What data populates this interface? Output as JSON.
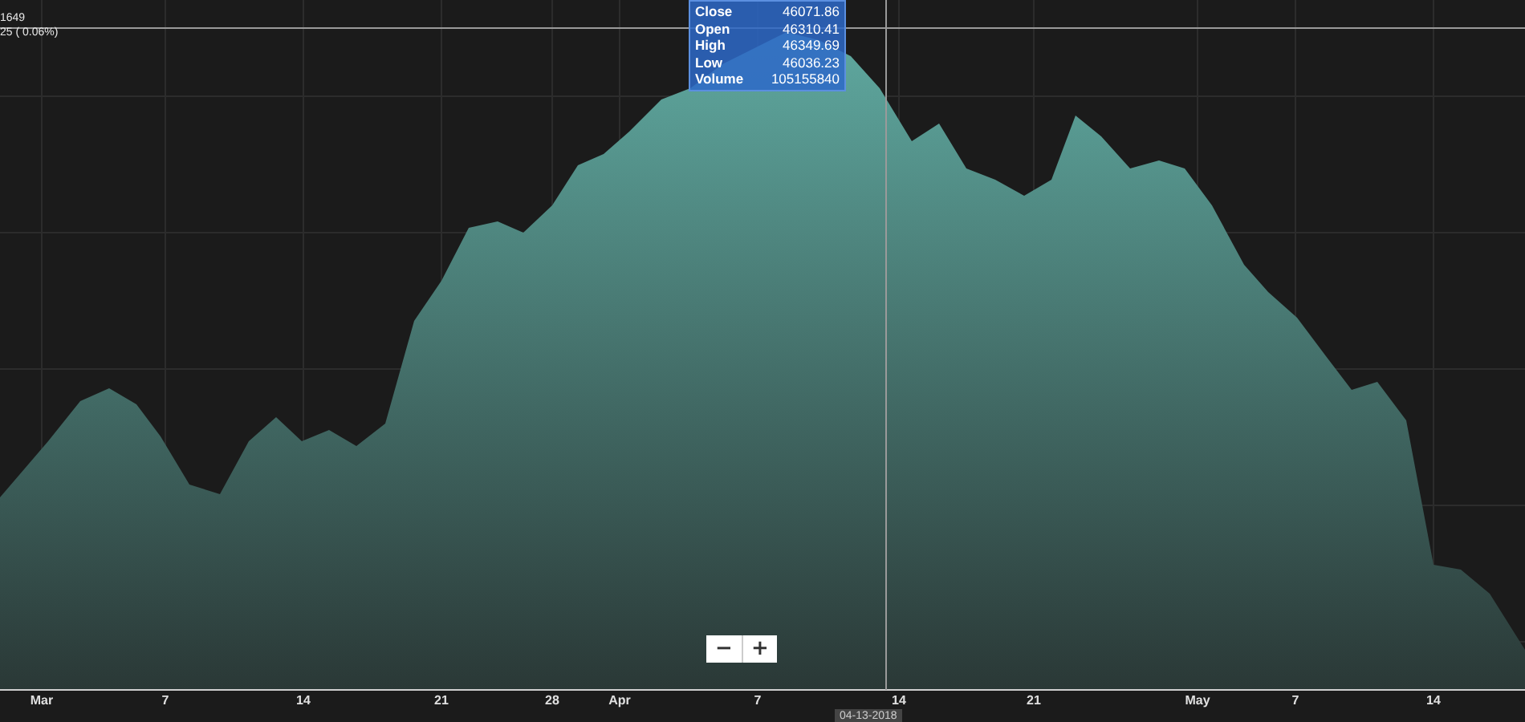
{
  "header": {
    "price": "1649",
    "change": "25 ( 0.06%)"
  },
  "tooltip": [
    {
      "label": "Close",
      "value": "46071.86"
    },
    {
      "label": "Open",
      "value": "46310.41"
    },
    {
      "label": "High",
      "value": "46349.69"
    },
    {
      "label": "Low",
      "value": "46036.23"
    },
    {
      "label": "Volume",
      "value": "105155840"
    }
  ],
  "zoom_buttons": [
    "−",
    "+"
  ],
  "x_axis": [
    "Mar",
    "7",
    "14",
    "21",
    "28",
    "Apr",
    "7",
    "14",
    "21",
    "May",
    "7",
    "14"
  ],
  "crosshair_date": "04-13-2018"
}
